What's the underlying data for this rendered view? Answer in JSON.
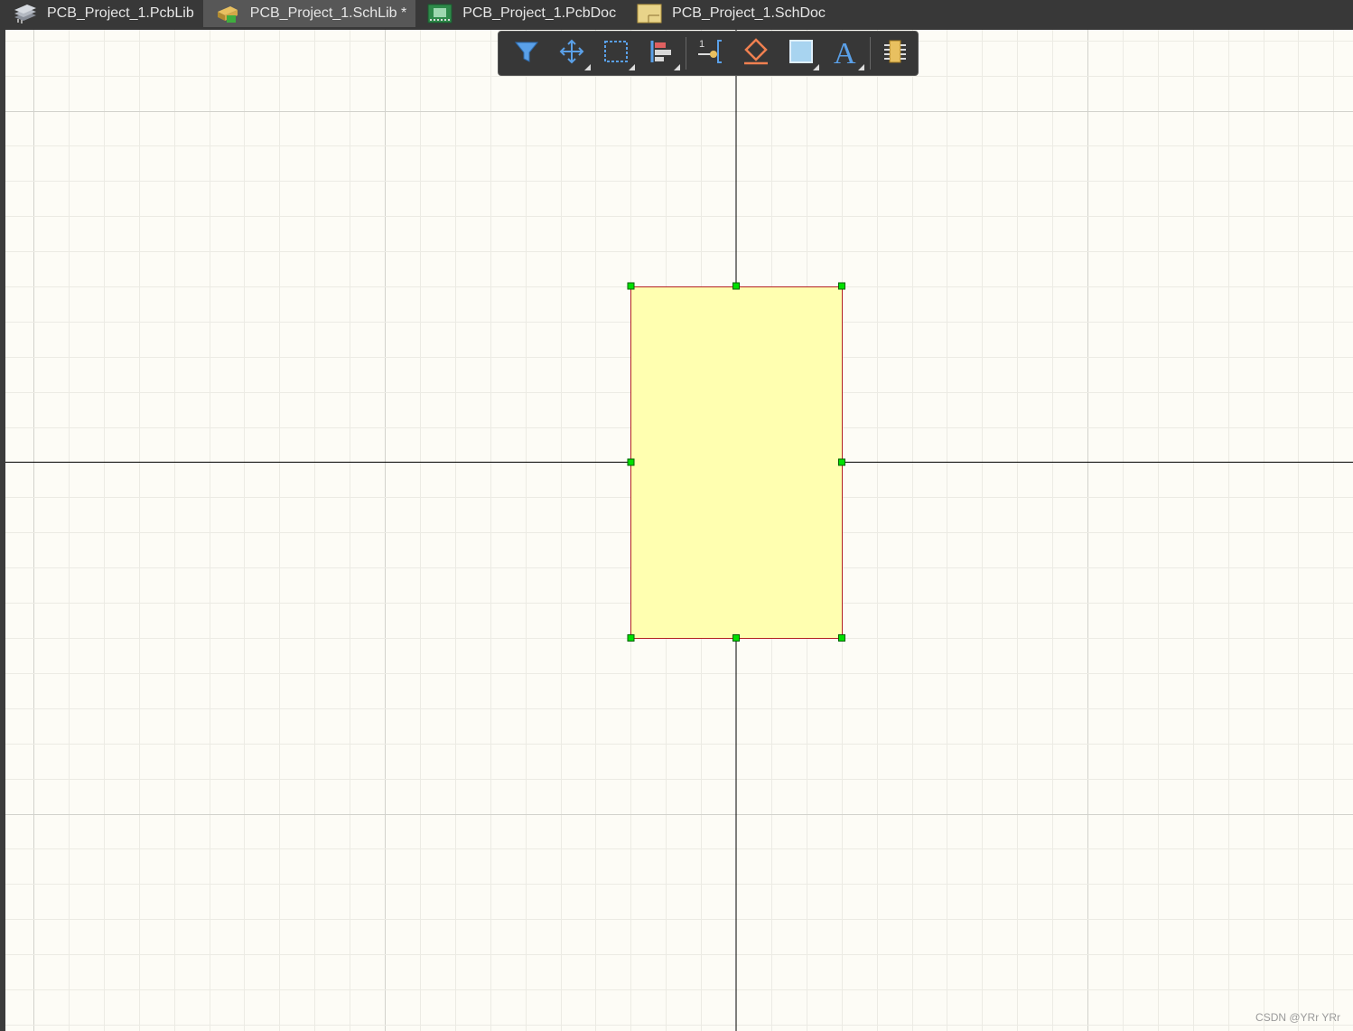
{
  "tabs": [
    {
      "label": "PCB_Project_1.PcbLib",
      "icon": "pcblib-icon",
      "active": false
    },
    {
      "label": "PCB_Project_1.SchLib *",
      "icon": "schlib-icon",
      "active": true
    },
    {
      "label": "PCB_Project_1.PcbDoc",
      "icon": "pcbdoc-icon",
      "active": false
    },
    {
      "label": "PCB_Project_1.SchDoc",
      "icon": "schdoc-icon",
      "active": false
    }
  ],
  "toolbar": {
    "buttons": [
      {
        "name": "filter-icon",
        "has_dropdown": false
      },
      {
        "name": "move-icon",
        "has_dropdown": true
      },
      {
        "name": "select-region-icon",
        "has_dropdown": true
      },
      {
        "name": "align-icon",
        "has_dropdown": true
      },
      {
        "name": "place-pin-icon",
        "has_dropdown": false
      },
      {
        "name": "place-ieee-symbol-icon",
        "has_dropdown": false
      },
      {
        "name": "place-rectangle-icon",
        "has_dropdown": true
      },
      {
        "name": "place-text-icon",
        "has_dropdown": true
      },
      {
        "name": "add-part-icon",
        "has_dropdown": false
      }
    ]
  },
  "colors": {
    "canvas_bg": "#fdfcf6",
    "rect_fill": "#ffffb0",
    "rect_border": "#b22222",
    "handle": "#00e000",
    "axis": "#000000"
  },
  "watermark": "CSDN @YRr YRr"
}
